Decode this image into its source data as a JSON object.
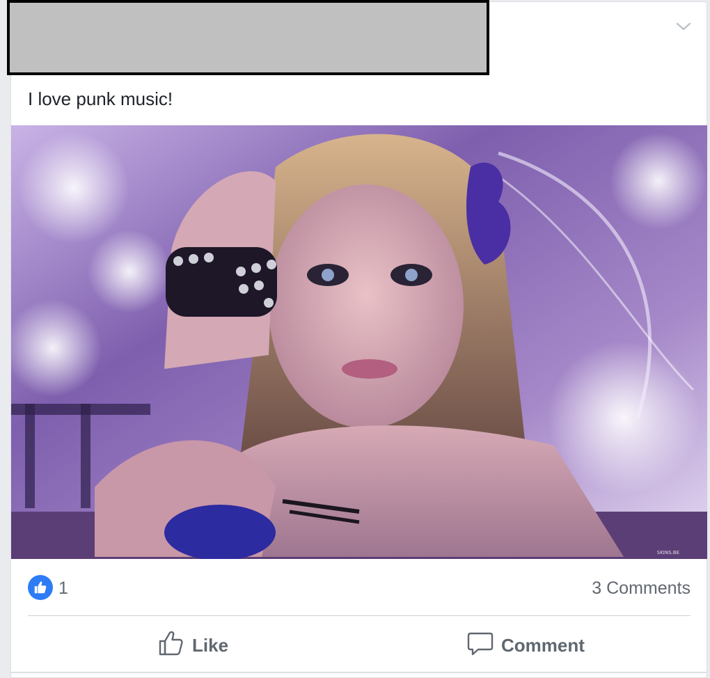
{
  "post": {
    "text": "I love punk music!",
    "photo_watermark": "SKINS.BE"
  },
  "reactions": {
    "like_count": "1",
    "comments_label": "3 Comments"
  },
  "actions": {
    "like_label": "Like",
    "comment_label": "Comment"
  },
  "icons": {
    "menu": "chevron-down-icon",
    "reaction": "thumbs-up-icon",
    "like": "thumbs-up-outline-icon",
    "comment": "speech-bubble-icon"
  },
  "colors": {
    "like_badge": "#2d7cf6",
    "action_text": "#606770",
    "post_text": "#1d2129",
    "redaction": "#c0c0c0"
  }
}
